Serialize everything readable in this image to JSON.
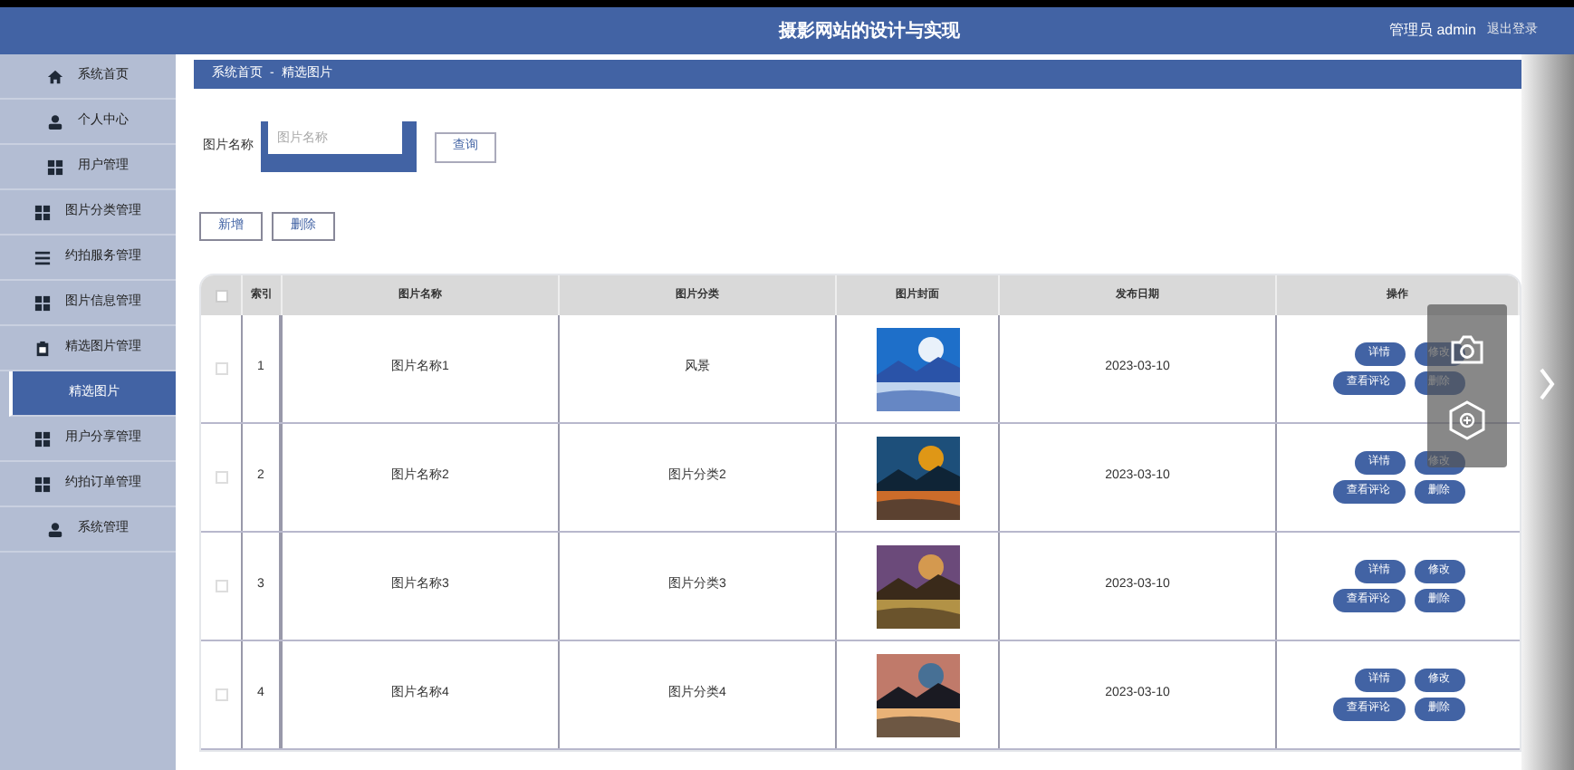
{
  "header": {
    "title": "摄影网站的设计与实现",
    "user": "管理员 admin",
    "logout": "退出登录"
  },
  "sidebar": {
    "items": [
      {
        "label": "系统首页",
        "kind": "home",
        "selected": false
      },
      {
        "label": "个人中心",
        "kind": "user",
        "selected": false
      },
      {
        "label": "用户管理",
        "kind": "grid",
        "selected": false
      },
      {
        "label": "图片分类管理",
        "kind": "grid",
        "selected": false
      },
      {
        "label": "约拍服务管理",
        "kind": "list",
        "selected": false
      },
      {
        "label": "图片信息管理",
        "kind": "grid",
        "selected": false
      },
      {
        "label": "精选图片管理",
        "kind": "clip",
        "selected": false
      },
      {
        "label": "精选图片",
        "kind": "plain",
        "selected": true
      },
      {
        "label": "用户分享管理",
        "kind": "grid",
        "selected": false
      },
      {
        "label": "约拍订单管理",
        "kind": "grid",
        "selected": false
      },
      {
        "label": "系统管理",
        "kind": "user",
        "selected": false
      }
    ]
  },
  "breadcrumb": [
    "系统首页",
    "-",
    "精选图片"
  ],
  "search": {
    "label": "图片名称",
    "placeholder": "图片名称",
    "button": "查询"
  },
  "actions": [
    "新增",
    "删除"
  ],
  "table": {
    "select_all": {
      "checked": false
    },
    "columns": [
      "索引",
      "图片名称",
      "图片分类",
      "图片封面",
      "发布日期",
      "操作"
    ],
    "rows": [
      {
        "index": "1",
        "name": "图片名称1",
        "category": "风景",
        "date": "2023-03-10",
        "checked": false,
        "buttons": [
          "详情",
          "修改",
          "查看评论",
          "删除"
        ]
      },
      {
        "index": "2",
        "name": "图片名称2",
        "category": "图片分类2",
        "date": "2023-03-10",
        "checked": false,
        "buttons": [
          "详情",
          "修改",
          "查看评论",
          "删除"
        ]
      },
      {
        "index": "3",
        "name": "图片名称3",
        "category": "图片分类3",
        "date": "2023-03-10",
        "checked": false,
        "buttons": [
          "详情",
          "修改",
          "查看评论",
          "删除"
        ]
      },
      {
        "index": "4",
        "name": "图片名称4",
        "category": "图片分类4",
        "date": "2023-03-10",
        "checked": false,
        "buttons": [
          "详情",
          "修改",
          "查看评论",
          "删除"
        ]
      }
    ]
  }
}
